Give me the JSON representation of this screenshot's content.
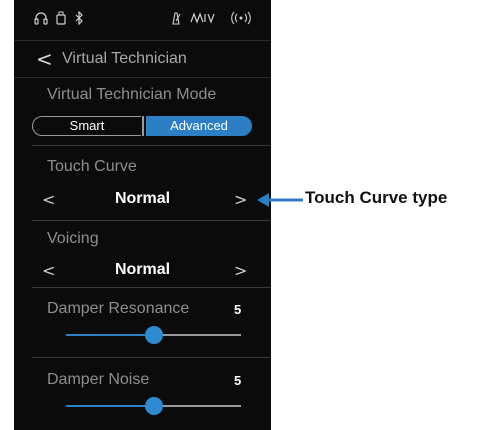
{
  "status_icons": [
    "headphones-icon",
    "usb-icon",
    "bluetooth-icon",
    "metronome-icon",
    "midi-icon",
    "wireless-icon"
  ],
  "header": {
    "back_icon": "chevron-left-icon",
    "back_glyph": "<",
    "title": "Virtual Technician"
  },
  "mode": {
    "label": "Virtual Technician Mode",
    "options": [
      "Smart",
      "Advanced"
    ],
    "selected": "Advanced"
  },
  "touch_curve": {
    "label": "Touch Curve",
    "value": "Normal",
    "prev_glyph": "<",
    "next_glyph": ">"
  },
  "voicing": {
    "label": "Voicing",
    "value": "Normal",
    "prev_glyph": "<",
    "next_glyph": ">"
  },
  "damper_resonance": {
    "label": "Damper Resonance",
    "value": "5",
    "level_fraction": 0.5
  },
  "damper_noise": {
    "label": "Damper Noise",
    "value": "5",
    "level_fraction": 0.5
  },
  "annotation": {
    "label": "Touch Curve type",
    "arrow_icon": "arrow-left-icon"
  },
  "colors": {
    "accent": "#2c7fc4",
    "screen_bg": "#0b0b0c",
    "text_dim": "#8e8e8e"
  }
}
